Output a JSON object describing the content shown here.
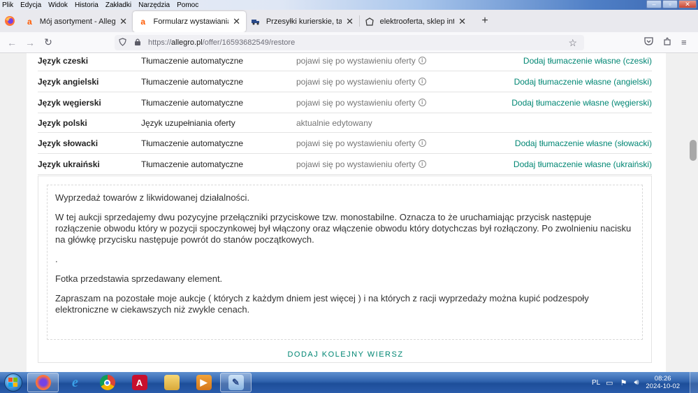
{
  "menu": [
    "Plik",
    "Edycja",
    "Widok",
    "Historia",
    "Zakładki",
    "Narzędzia",
    "Pomoc"
  ],
  "tabs": [
    {
      "title": "Mój asortyment - Allegro",
      "icon": "allegro-icon",
      "active": false
    },
    {
      "title": "Formularz wystawiania",
      "icon": "allegro-icon",
      "active": true
    },
    {
      "title": "Przesyłki kurierskie, tani kurier",
      "icon": "courier-icon",
      "active": false
    },
    {
      "title": "elektrooferta, sklep internetowy",
      "icon": "shop-icon",
      "active": false
    }
  ],
  "url": {
    "prefix": "https://",
    "host": "allegro.pl",
    "path": "/offer/16593682549/restore"
  },
  "languages": [
    {
      "name": "Język czeski",
      "type": "Tłumaczenie automatyczne",
      "status": "pojawi się po wystawieniu oferty",
      "info": true,
      "action": "Dodaj tłumaczenie własne (czeski)"
    },
    {
      "name": "Język angielski",
      "type": "Tłumaczenie automatyczne",
      "status": "pojawi się po wystawieniu oferty",
      "info": true,
      "action": "Dodaj tłumaczenie własne (angielski)"
    },
    {
      "name": "Język węgierski",
      "type": "Tłumaczenie automatyczne",
      "status": "pojawi się po wystawieniu oferty",
      "info": true,
      "action": "Dodaj tłumaczenie własne (węgierski)"
    },
    {
      "name": "Język polski",
      "type": "Język uzupełniania oferty",
      "status": "aktualnie edytowany",
      "info": false,
      "action": ""
    },
    {
      "name": "Język słowacki",
      "type": "Tłumaczenie automatyczne",
      "status": "pojawi się po wystawieniu oferty",
      "info": true,
      "action": "Dodaj tłumaczenie własne (słowacki)"
    },
    {
      "name": "Język ukraiński",
      "type": "Tłumaczenie automatyczne",
      "status": "pojawi się po wystawieniu oferty",
      "info": true,
      "action": "Dodaj tłumaczenie własne (ukraiński)"
    }
  ],
  "description": {
    "paragraphs": [
      "Wyprzedaż towarów z likwidowanej działalności.",
      "W tej aukcji sprzedajemy dwu pozycyjne przełączniki przyciskowe tzw. monostabilne. Oznacza to że uruchamiając przycisk następuje rozłączenie obwodu który w pozycji spoczynkowej był włączony oraz włączenie obwodu który dotychczas był rozłączony. Po zwolnieniu nacisku na główkę przycisku następuje powrót do stanów początkowych.",
      ".",
      "Fotka przedstawia sprzedawany element.",
      "Zapraszam na pozostałe moje aukcje ( których z każdym dniem jest więcej ) i na których z racji wyprzedaży można kupić podzespoły elektroniczne w ciekawszych niż zwykle cenach."
    ],
    "add_row_label": "DODAJ KOLEJNY WIERSZ"
  },
  "tray": {
    "language": "PL",
    "time": "08:26",
    "date": "2024-10-02"
  },
  "colors": {
    "accent": "#008673",
    "taskbar": "#2f62ad"
  }
}
